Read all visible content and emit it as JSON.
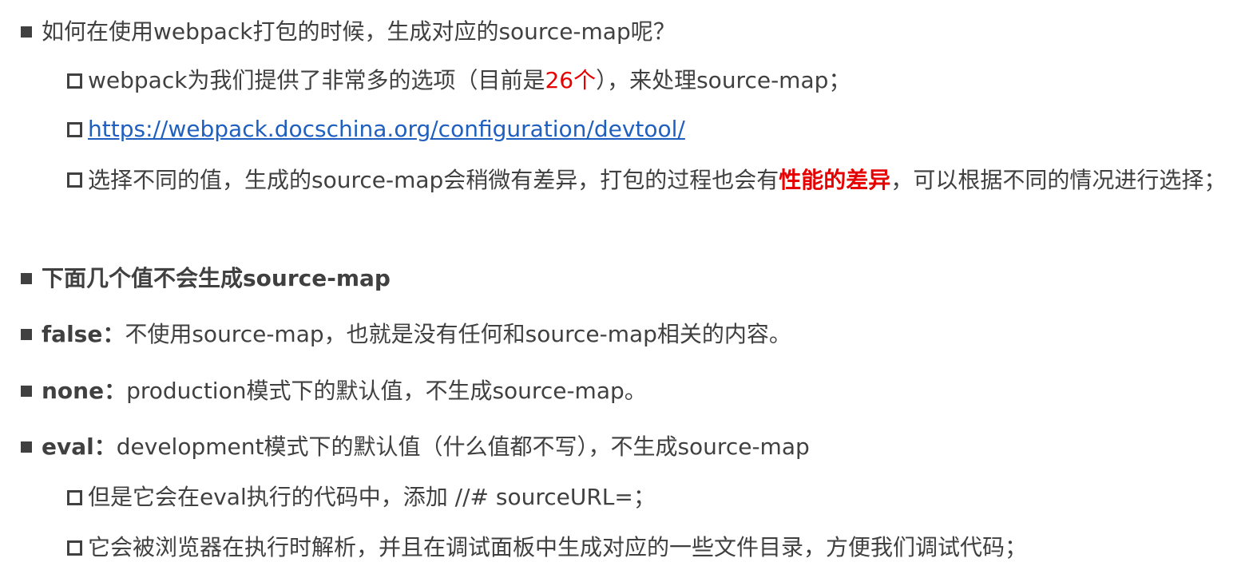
{
  "items": [
    {
      "text": "如何在使用webpack打包的时候，生成对应的source-map呢？"
    },
    {
      "sub": [
        {
          "pre": "webpack为我们提供了非常多的选项（目前是",
          "highlight": "26个",
          "post": "），来处理source-map；"
        },
        {
          "link": "https://webpack.docschina.org/configuration/devtool/"
        },
        {
          "pre": "选择不同的值，生成的source-map会稍微有差异，打包的过程也会有",
          "highlight": "性能的差异",
          "post": "，可以根据不同的情况进行选择；"
        }
      ]
    },
    {
      "text": "下面几个值不会生成source-map"
    },
    {
      "term": "false：",
      "text": "不使用source-map，也就是没有任何和source-map相关的内容。"
    },
    {
      "term": "none：",
      "text": "production模式下的默认值，不生成source-map。"
    },
    {
      "term": "eval：",
      "text": "development模式下的默认值（什么值都不写），不生成source-map"
    },
    {
      "sub": [
        {
          "text": "但是它会在eval执行的代码中，添加 //# sourceURL=；"
        },
        {
          "text": "它会被浏览器在执行时解析，并且在调试面板中生成对应的一些文件目录，方便我们调试代码；"
        }
      ]
    }
  ],
  "colors": {
    "text": "#404040",
    "highlight": "#e60000",
    "link": "#1f5fbf"
  }
}
